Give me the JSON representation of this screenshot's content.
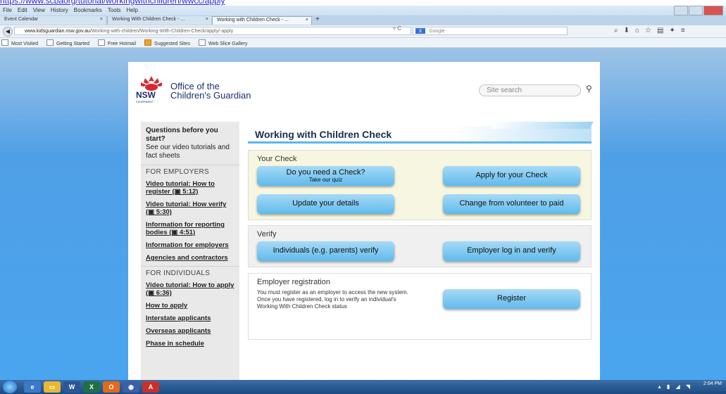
{
  "top_url_fragment": "https://www.scbaorg/tutorial/workingwithchildren/wwcc/apply",
  "menubar": [
    "File",
    "Edit",
    "View",
    "History",
    "Bookmarks",
    "Tools",
    "Help"
  ],
  "tabs": [
    {
      "label": "Event Calendar"
    },
    {
      "label": "Working With Children Check - ..."
    },
    {
      "label": "Working with Children Check - ..."
    }
  ],
  "newtab_glyph": "+",
  "address": {
    "host": "www.kidsguardian.nsw.gov.au",
    "path": "/Working-with-children/Working-With-Children-Check/apply/-apply",
    "reload_glyph": "▿ C"
  },
  "search": {
    "engine": "8",
    "placeholder": "Google"
  },
  "bookmarks": [
    "Most Visited",
    "Getting Started",
    "Free Hotmail",
    "Suggested Sites",
    "Web Slice Gallery"
  ],
  "site": {
    "logo_text": "NSW",
    "logo_sub": "GOVERNMENT",
    "org_line1": "Office of the",
    "org_line2": "Children's Guardian",
    "search_placeholder": "Site search"
  },
  "leftnav": {
    "intro_bold": "Questions before you start?",
    "intro_text": "See our video tutorials and fact sheets",
    "employers_heading": "FOR EMPLOYERS",
    "employer_links": [
      "Video tutorial: How to register (▣ 5:12)",
      "Video tutorial: How verify (▣ 5:30)",
      "Information for reporting bodies (▣ 4:51)",
      "Information for employers",
      "Agencies and contractors"
    ],
    "individuals_heading": "FOR INDIVIDUALS",
    "individual_links": [
      "Video tutorial: How to apply (▣ 6:36)",
      "How to apply",
      "Interstate applicants",
      "Overseas applicants",
      "Phase in schedule"
    ]
  },
  "main": {
    "title": "Working with Children Check",
    "your_check": {
      "heading": "Your Check",
      "need_check": "Do you need a Check?",
      "need_check_sub": "Take our quiz",
      "apply": "Apply for your Check",
      "update": "Update your details",
      "change": "Change from volunteer to paid"
    },
    "verify": {
      "heading": "Verify",
      "individuals": "Individuals (e.g. parents) verify",
      "employer": "Employer log in and verify"
    },
    "registration": {
      "heading": "Employer registration",
      "text1": "You must register as an employer to access the new system.",
      "text2": "Once you have registered, log in to verify an individual's",
      "text3": "Working With Children Check status",
      "register": "Register"
    }
  },
  "taskbar": {
    "time": "2:04 PM",
    "apps": [
      "W",
      "X",
      "O",
      "A"
    ]
  }
}
